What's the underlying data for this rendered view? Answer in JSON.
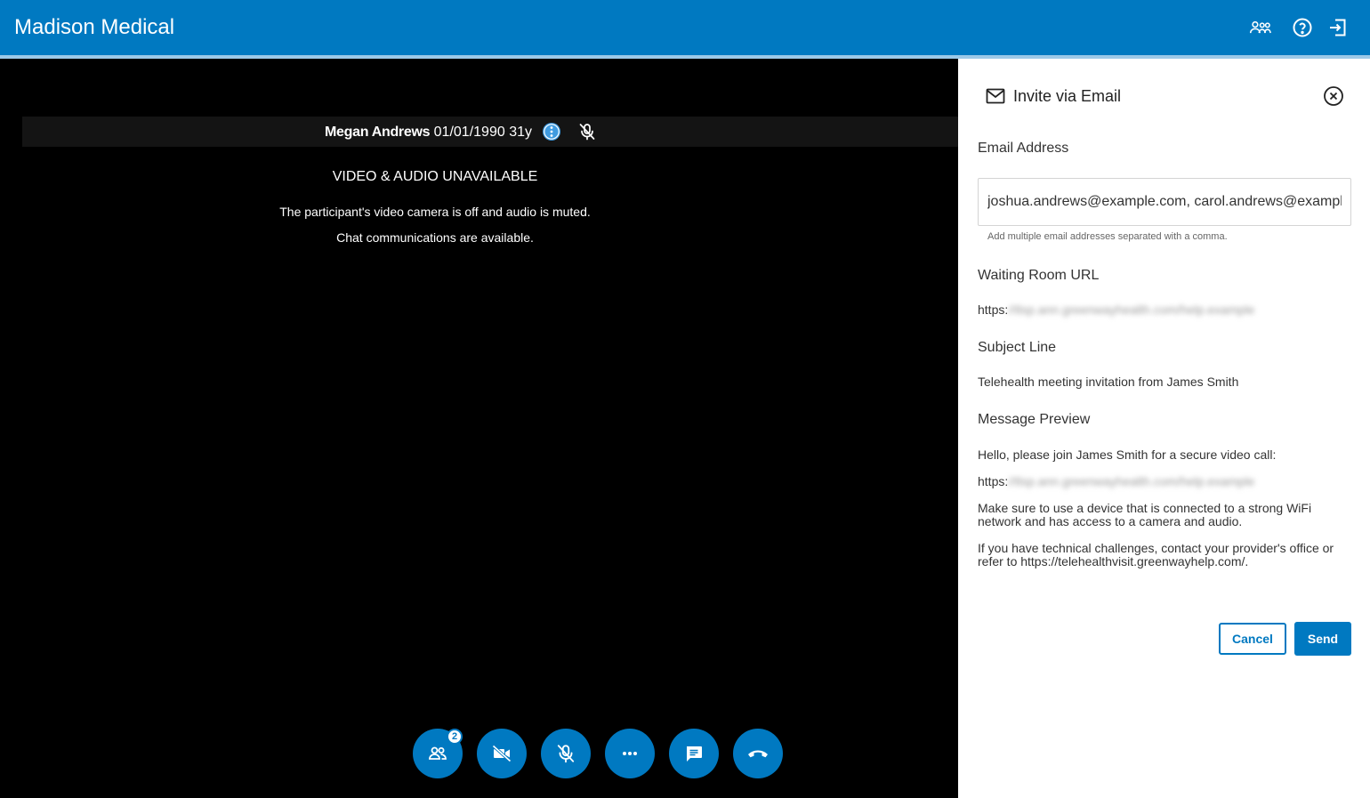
{
  "header": {
    "title": "Madison Medical",
    "icons": [
      "participants-icon",
      "help-icon",
      "logout-icon"
    ]
  },
  "participant": {
    "name": "Megan Andrews",
    "dob": "01/01/1990",
    "age": "31y"
  },
  "video_status": {
    "title": "VIDEO & AUDIO UNAVAILABLE",
    "line1": "The participant's video camera is off and audio is muted.",
    "line2": "Chat communications are available."
  },
  "controls": {
    "participant_count": "2",
    "icons": [
      "people-icon",
      "video-off-icon",
      "mic-off-icon",
      "more-icon",
      "chat-icon",
      "hang-up-icon"
    ]
  },
  "invite_panel": {
    "title": "Invite via Email",
    "email_label": "Email Address",
    "email_value": "joshua.andrews@example.com, carol.andrews@example.com",
    "email_hint": "Add multiple email addresses separated with a comma.",
    "url_label": "Waiting Room URL",
    "url_prefix": "https:",
    "url_blurred": "//tlsp.ann.greenwayhealth.com/help.example",
    "subject_label": "Subject Line",
    "subject_value": "Telehealth meeting invitation from James Smith",
    "preview_label": "Message Preview",
    "preview_line1": "Hello, please join James Smith for a secure video call:",
    "preview_url_prefix": "https:",
    "preview_url_blurred": "//tlsp.ann.greenwayhealth.com/help.example",
    "preview_para2": "Make sure to use a device that is connected to a strong WiFi network and has access to a camera and audio.",
    "preview_para3": "If you have technical challenges, contact your provider's office or refer to https://telehealthvisit.greenwayhelp.com/.",
    "cancel_label": "Cancel",
    "send_label": "Send"
  },
  "colors": {
    "brand": "#0079c1",
    "header_strip": "#9cc9e8",
    "video_bg": "#000000",
    "name_bar": "#141414"
  }
}
